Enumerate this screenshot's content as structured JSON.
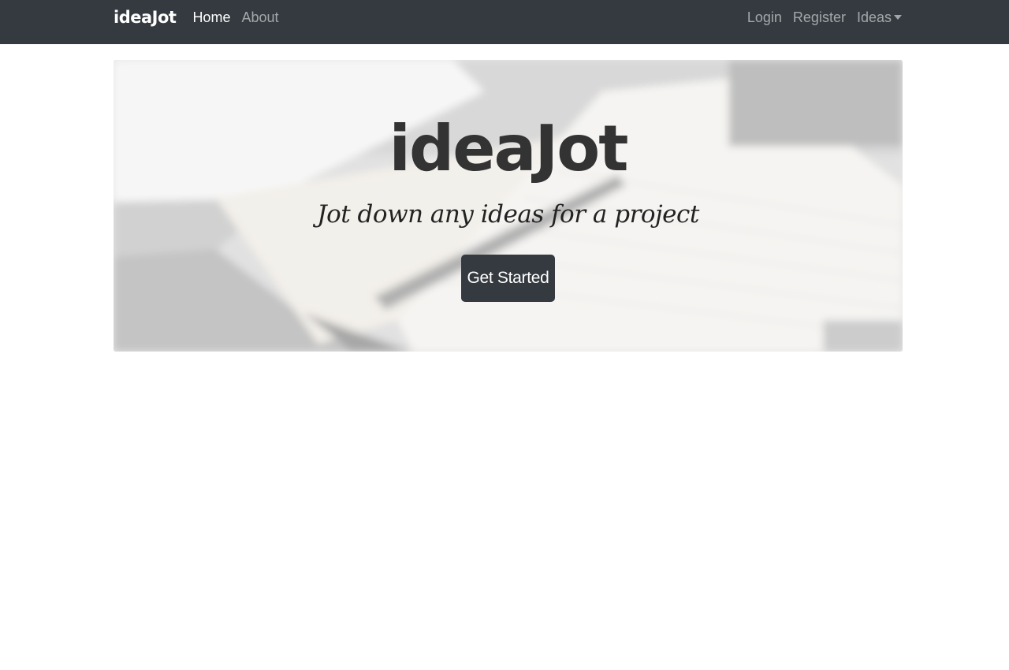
{
  "navbar": {
    "brand": "ideaJot",
    "links_left": [
      {
        "label": "Home",
        "active": true
      },
      {
        "label": "About",
        "active": false
      }
    ],
    "links_right": [
      {
        "label": "Login"
      },
      {
        "label": "Register"
      },
      {
        "label": "Ideas",
        "dropdown": true
      }
    ]
  },
  "hero": {
    "title": "ideaJot",
    "subtitle": "Jot down any ideas for a project",
    "cta_label": "Get Started"
  },
  "colors": {
    "navbar_bg": "#343a40",
    "button_bg": "#343a40",
    "page_bg": "#ffffff"
  }
}
